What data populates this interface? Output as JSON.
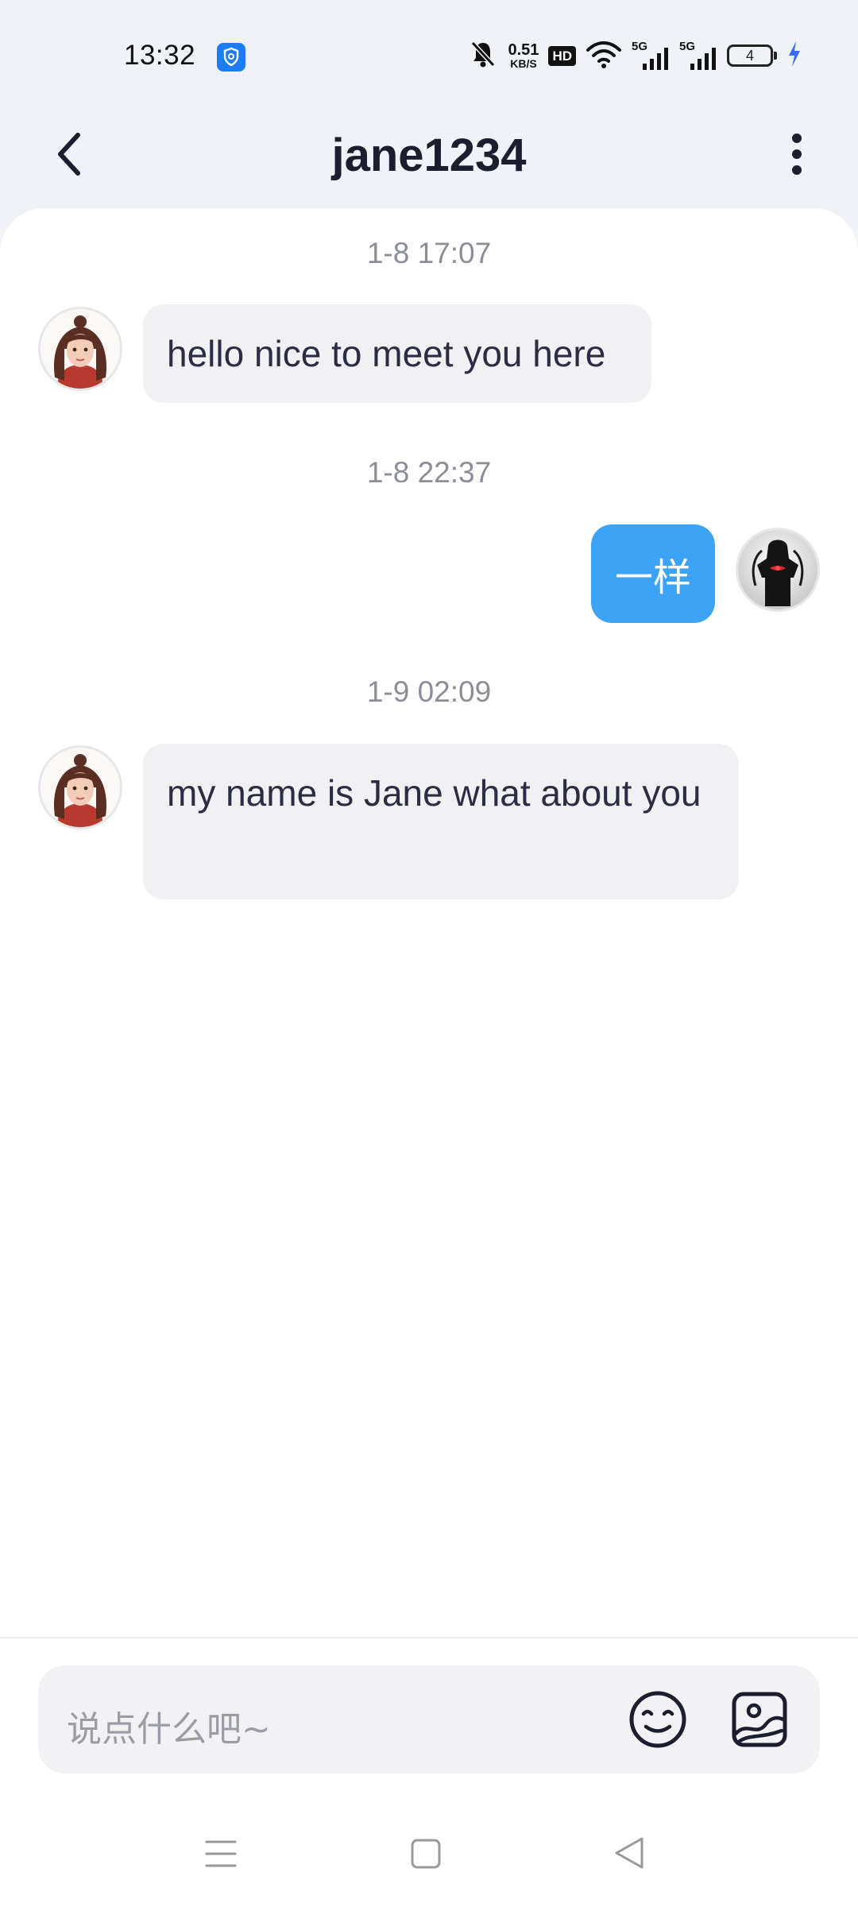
{
  "status_bar": {
    "time": "13:32",
    "net_speed_value": "0.51",
    "net_speed_unit": "KB/S",
    "hd_label": "HD",
    "signal_1_label": "5G",
    "signal_2_label": "5G",
    "battery_level": "4",
    "icons": [
      "shield-icon",
      "mute-bell-icon",
      "wifi-icon",
      "signal-icon",
      "battery-icon",
      "charging-icon"
    ]
  },
  "header": {
    "title": "jane1234",
    "back_icon": "chevron-left-icon",
    "more_icon": "more-vertical-icon"
  },
  "messages": [
    {
      "timestamp": "1-8 17:07",
      "direction": "incoming",
      "text": "hello nice to meet you here"
    },
    {
      "timestamp": "1-8 22:37",
      "direction": "outgoing",
      "text": "一样"
    },
    {
      "timestamp": "1-9 02:09",
      "direction": "incoming",
      "text": "my name is Jane what about you"
    }
  ],
  "input": {
    "placeholder": "说点什么吧~",
    "emoji_icon": "emoji-icon",
    "image_icon": "image-icon"
  },
  "colors": {
    "background": "#eff3f7",
    "outgoing_bubble": "#3da3f6",
    "incoming_bubble": "#f1f1f4",
    "timestamp_text": "#8b8e97",
    "title_text": "#1b1e2e"
  }
}
